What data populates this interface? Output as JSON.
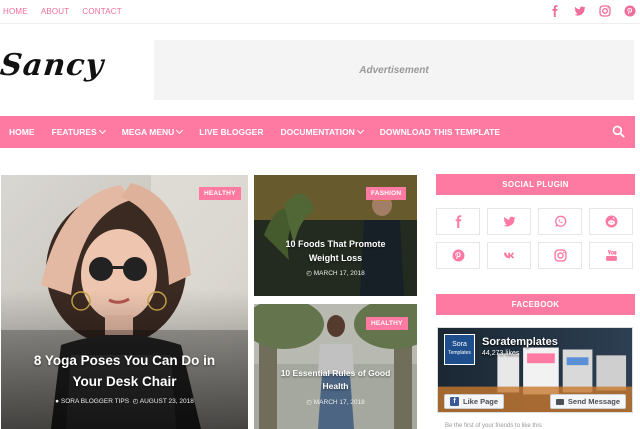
{
  "top_nav": {
    "links": [
      "HOME",
      "ABOUT",
      "CONTACT"
    ],
    "social_icons": [
      "facebook-icon",
      "twitter-icon",
      "instagram-icon",
      "pinterest-icon"
    ]
  },
  "header": {
    "logo_text": "Sancy",
    "ad_text": "Advertisement"
  },
  "main_nav": {
    "items": [
      {
        "label": "HOME",
        "dropdown": false
      },
      {
        "label": "FEATURES",
        "dropdown": true
      },
      {
        "label": "MEGA MENU",
        "dropdown": true
      },
      {
        "label": "LIVE BLOGGER",
        "dropdown": false
      },
      {
        "label": "DOCUMENTATION",
        "dropdown": true
      },
      {
        "label": "DOWNLOAD THIS TEMPLATE",
        "dropdown": false
      }
    ],
    "search_icon": "search-icon"
  },
  "featured": {
    "big": {
      "tag": "HEALTHY",
      "title_line1": "8 Yoga Poses You Can Do in",
      "title_line2": "Your Desk Chair",
      "author": "SORA BLOGGER TIPS",
      "date": "AUGUST 23, 2018"
    },
    "top_right": {
      "tag": "FASHION",
      "title_line1": "10 Foods That Promote",
      "title_line2": "Weight Loss",
      "date": "MARCH 17, 2018"
    },
    "bottom_right": {
      "tag": "HEALTHY",
      "title_line1": "10 Essential Rules of Good",
      "title_line2": "Health",
      "date": "MARCH 17, 2018"
    }
  },
  "sidebar": {
    "social_title": "SOCIAL PLUGIN",
    "social_buttons": [
      "facebook-icon",
      "twitter-icon",
      "whatsapp-icon",
      "reddit-icon",
      "pinterest-icon",
      "vk-icon",
      "instagram-icon",
      "youtube-icon"
    ],
    "facebook_title": "FACEBOOK",
    "fb_widget": {
      "logo_line1": "Sora",
      "logo_line2": "Templates",
      "page_name": "Soratemplates",
      "likes": "44,273 likes",
      "like_button": "Like Page",
      "message_button": "Send Message",
      "footer": "Be the first of your friends to like this"
    }
  },
  "colors": {
    "accent": "#ff7aa3",
    "toplink": "#f06c9b"
  }
}
